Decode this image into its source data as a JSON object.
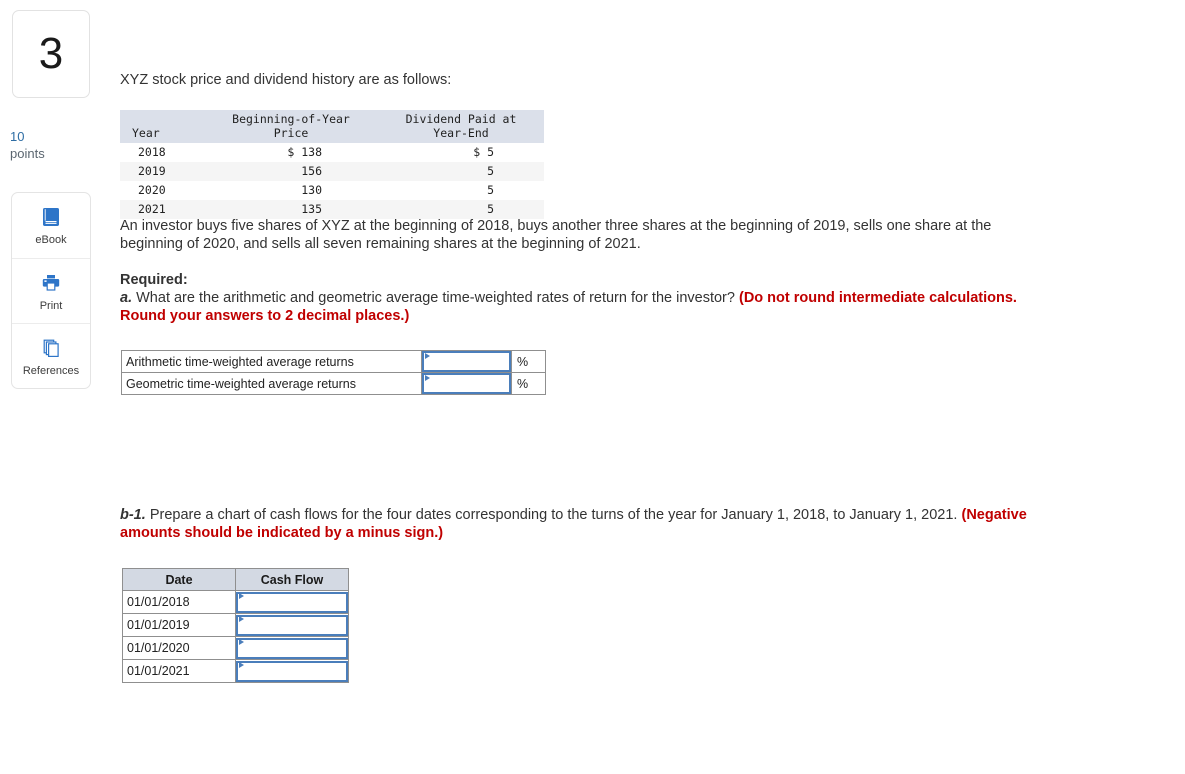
{
  "question": {
    "number": "3",
    "points_value": "10",
    "points_label": "points"
  },
  "tools": [
    {
      "label": "eBook",
      "icon": "ebook-icon"
    },
    {
      "label": "Print",
      "icon": "print-icon"
    },
    {
      "label": "References",
      "icon": "references-icon"
    }
  ],
  "colors": {
    "accent_blue": "#2e6da4",
    "input_border_blue": "#4a7ebb",
    "red_note": "#c00000",
    "table_header_bg": "#d3d9e3",
    "data_header_bg": "#dbe0ea",
    "stripe_bg": "#f5f5f5"
  },
  "main": {
    "intro": "XYZ stock price and dividend history are as follows:",
    "price_table": {
      "headers": [
        "Year",
        "Beginning-of-Year\nPrice",
        "Dividend Paid at\nYear-End"
      ],
      "header_year": "Year",
      "header_price_line1": "Beginning-of-Year",
      "header_price_line2": "Price",
      "header_div_line1": "Dividend Paid at",
      "header_div_line2": "Year-End",
      "rows": [
        {
          "year": "2018",
          "price": "$ 138",
          "dividend": "$ 5"
        },
        {
          "year": "2019",
          "price": "156",
          "dividend": "5"
        },
        {
          "year": "2020",
          "price": "130",
          "dividend": "5"
        },
        {
          "year": "2021",
          "price": "135",
          "dividend": "5"
        }
      ]
    },
    "paragraph": "An investor buys five shares of XYZ at the beginning of 2018, buys another three shares at the beginning of 2019, sells one share at the beginning of 2020, and sells all seven remaining shares at the beginning of 2021.",
    "required_title": "Required:",
    "part_a": {
      "letter": "a.",
      "text": "What are the arithmetic and geometric average time-weighted rates of return for the investor?",
      "note": "(Do not round intermediate calculations. Round your answers to 2 decimal places.)",
      "rows": [
        {
          "label": "Arithmetic time-weighted average returns",
          "value": "",
          "unit": "%"
        },
        {
          "label": "Geometric time-weighted average returns",
          "value": "",
          "unit": "%"
        }
      ]
    },
    "part_b1": {
      "letter": "b-1.",
      "text": "Prepare a chart of cash flows for the four dates corresponding to the turns of the year for January 1, 2018, to January 1, 2021.",
      "note": "(Negative amounts should be indicated by a minus sign.)",
      "table": {
        "header_date": "Date",
        "header_cashflow": "Cash Flow",
        "rows": [
          {
            "date": "01/01/2018",
            "cash_flow": ""
          },
          {
            "date": "01/01/2019",
            "cash_flow": ""
          },
          {
            "date": "01/01/2020",
            "cash_flow": ""
          },
          {
            "date": "01/01/2021",
            "cash_flow": ""
          }
        ]
      }
    }
  }
}
